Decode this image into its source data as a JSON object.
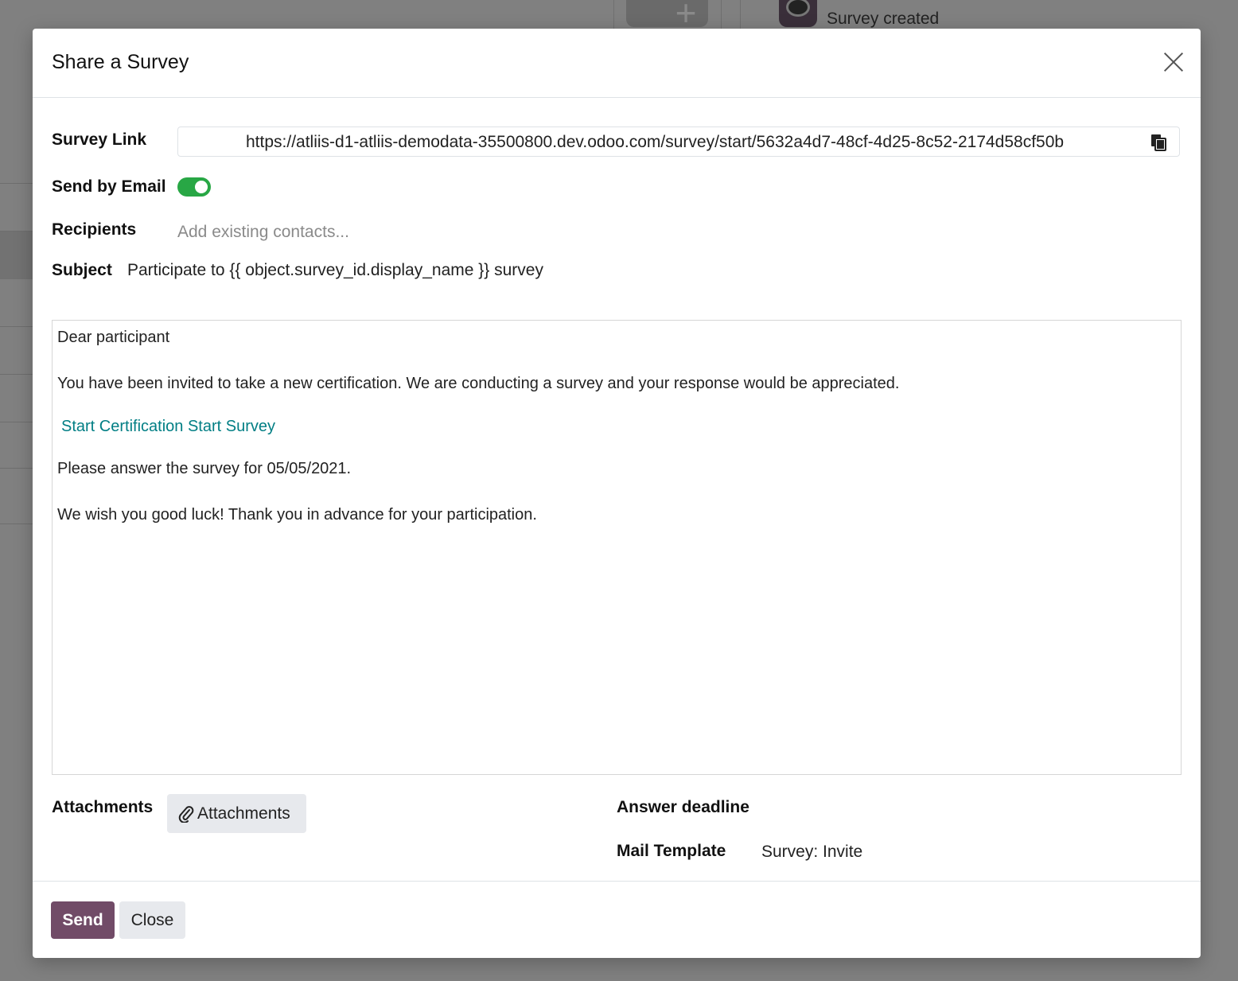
{
  "background": {
    "chatter_message": "Survey created"
  },
  "dialog": {
    "title": "Share a Survey"
  },
  "form": {
    "survey_link_label": "Survey Link",
    "survey_link_value": "https://atliis-d1-atliis-demodata-35500800.dev.odoo.com/survey/start/5632a4d7-48cf-4d25-8c52-2174d58cf50b",
    "send_by_email_label": "Send by Email",
    "send_by_email_enabled": true,
    "recipients_label": "Recipients",
    "recipients_placeholder": "Add existing contacts...",
    "subject_label": "Subject",
    "subject_value": "Participate to {{ object.survey_id.display_name }} survey"
  },
  "email_body": {
    "greeting": "Dear participant",
    "paragraph": "You have been invited to take a new certification. We are conducting a survey and your response would be appreciated.",
    "link_text": "Start Certification Start Survey",
    "deadline_line": "Please answer the survey for 05/05/2021.",
    "closing": "We wish you good luck! Thank you in advance for your participation."
  },
  "bottom": {
    "attachments_label": "Attachments",
    "attachments_button": "Attachments",
    "answer_deadline_label": "Answer deadline",
    "mail_template_label": "Mail Template",
    "mail_template_value": "Survey: Invite"
  },
  "footer": {
    "send_label": "Send",
    "close_label": "Close"
  },
  "colors": {
    "primary": "#714b67",
    "toggle_on": "#28a745",
    "link": "#017e84"
  }
}
